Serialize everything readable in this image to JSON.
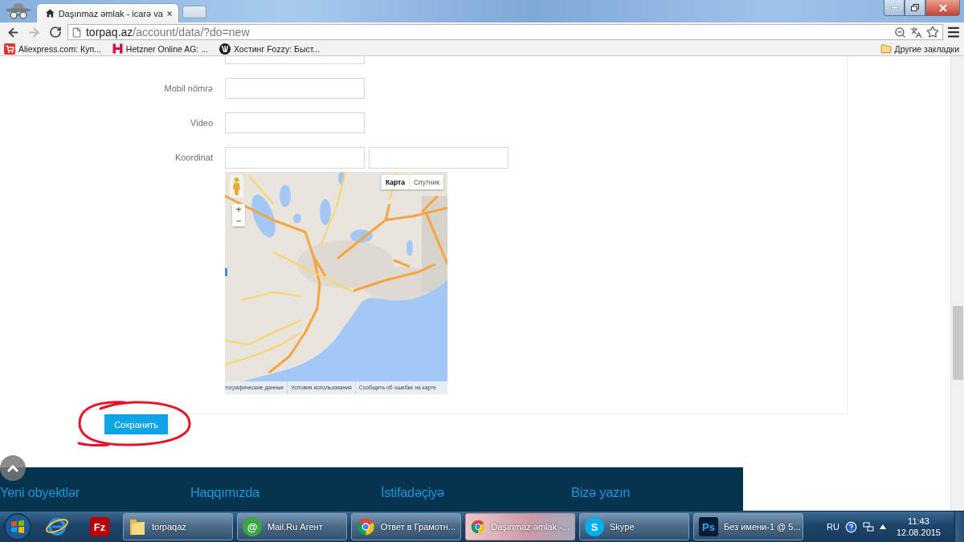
{
  "browser": {
    "tabs": [
      {
        "title": "Daşınmaz əmlak - icarə va",
        "selected": true
      }
    ],
    "address": {
      "host": "torpaq.az",
      "path": "/account/data/?do=new"
    },
    "bookmarks": [
      {
        "kind": "cart",
        "label": "Aliexpress.com: Куп..."
      },
      {
        "kind": "h",
        "label": "Hetzner Online AG: ..."
      },
      {
        "kind": "v",
        "label": "Хостинг Fozzy: Быст..."
      }
    ],
    "other_bookmarks": "Другие закладки"
  },
  "form": {
    "fields": [
      {
        "kind": "partial"
      },
      {
        "kind": "single",
        "label": "Mobil nömrə"
      },
      {
        "kind": "single",
        "label": "Video"
      },
      {
        "kind": "pair",
        "label": "Koordinat"
      }
    ],
    "map": {
      "type_buttons": [
        {
          "label": "Карта",
          "selected": true
        },
        {
          "label": "Спутник",
          "selected": false
        }
      ],
      "zoom_in": "+",
      "zoom_out": "−",
      "footer_links": [
        "тографические данные",
        "Условия использования",
        "Сообщить об ошибке на карте"
      ]
    },
    "submit": "Сохранить"
  },
  "footer": {
    "links": [
      "Yeni obyektlər",
      "Haqqımızda",
      "İstifadəçiyə",
      "Bizə yazın"
    ]
  },
  "taskbar": {
    "pinned": [
      {
        "kind": "ie"
      },
      {
        "kind": "filezilla",
        "icon_text": "Fz"
      }
    ],
    "windows": [
      {
        "kind": "folder",
        "label": "torpaqaz",
        "selected": false
      },
      {
        "kind": "mail",
        "icon_text": "@",
        "label": "Mail.Ru Агент",
        "selected": false
      },
      {
        "kind": "chrome",
        "label": "Ответ в Грамотн...",
        "selected": false
      },
      {
        "kind": "chrome",
        "label": "Daşınmaz əmlak -...",
        "selected": true
      },
      {
        "kind": "skype",
        "icon_text": "S",
        "label": "Skype",
        "selected": false
      },
      {
        "kind": "photoshop",
        "icon_text": "Ps",
        "label": "Без имени-1 @ 5...",
        "selected": false
      }
    ],
    "language": "RU",
    "time": "11:43",
    "date": "12.08.2015"
  }
}
